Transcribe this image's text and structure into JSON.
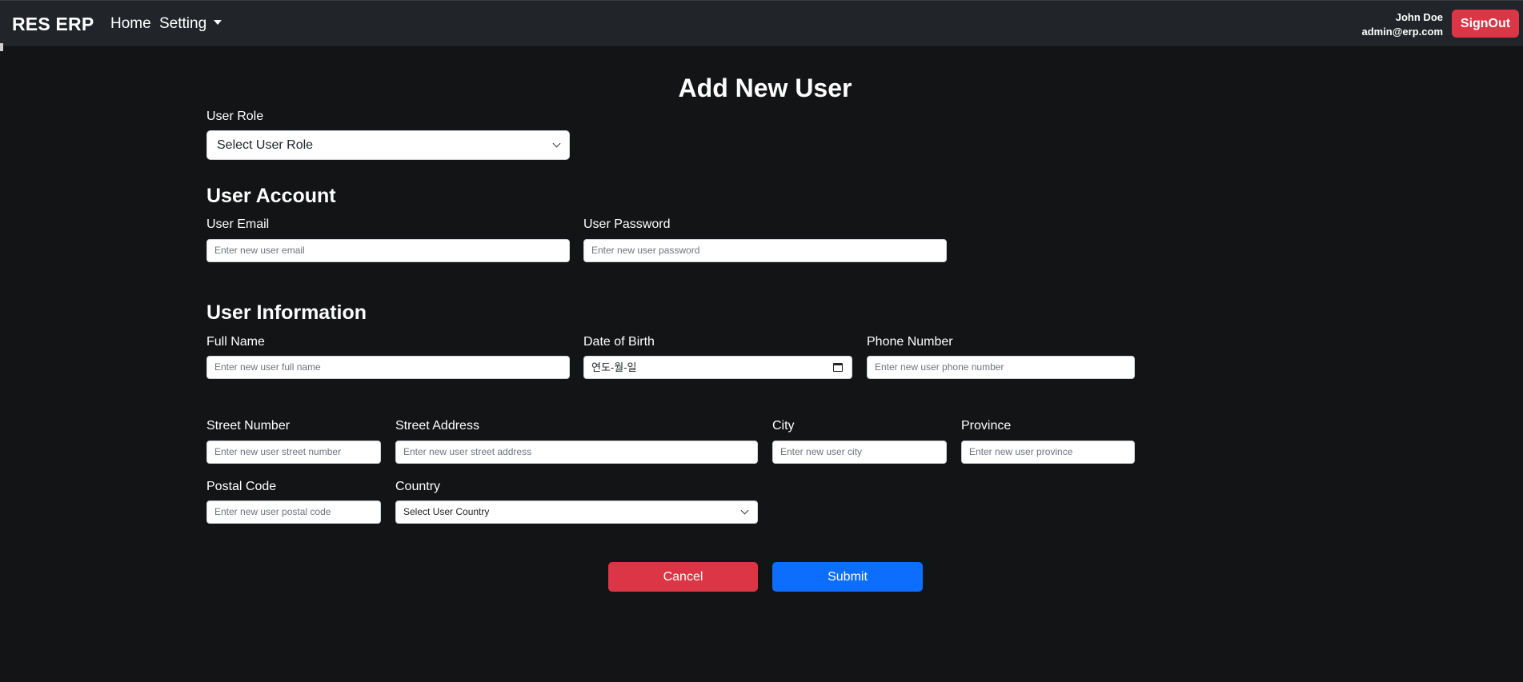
{
  "navbar": {
    "brand": "RES ERP",
    "home": "Home",
    "setting": "Setting",
    "user_name": "John Doe",
    "user_email": "admin@erp.com",
    "signout": "SignOut"
  },
  "form": {
    "title": "Add New User",
    "user_role": {
      "label": "User Role",
      "selected": "Select User Role"
    },
    "account": {
      "heading": "User Account",
      "email_label": "User Email",
      "email_placeholder": "Enter new user email",
      "password_label": "User Password",
      "password_placeholder": "Enter new user password"
    },
    "information": {
      "heading": "User Information",
      "full_name_label": "Full Name",
      "full_name_placeholder": "Enter new user full name",
      "dob_label": "Date of Birth",
      "dob_value": "연도-월-일",
      "phone_label": "Phone Number",
      "phone_placeholder": "Enter new user phone number"
    },
    "address": {
      "street_number_label": "Street Number",
      "street_number_placeholder": "Enter new user street number",
      "street_address_label": "Street Address",
      "street_address_placeholder": "Enter new user street address",
      "city_label": "City",
      "city_placeholder": "Enter new user city",
      "province_label": "Province",
      "province_placeholder": "Enter new user province",
      "postal_code_label": "Postal Code",
      "postal_code_placeholder": "Enter new user postal code",
      "country_label": "Country",
      "country_selected": "Select User Country"
    },
    "buttons": {
      "cancel": "Cancel",
      "submit": "Submit"
    }
  },
  "colors": {
    "background": "#131416",
    "navbar": "#212529",
    "danger": "#dc3545",
    "primary": "#0d6efd"
  }
}
